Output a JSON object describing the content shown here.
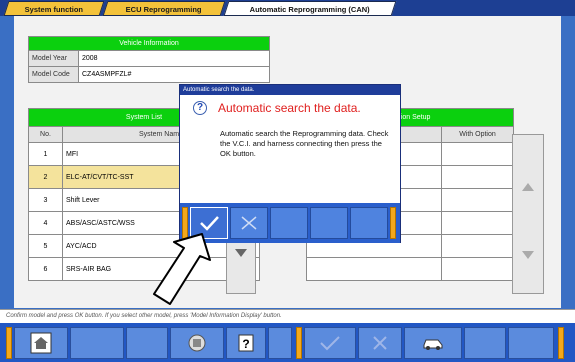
{
  "tabs": [
    "System function",
    "ECU Reprogramming",
    "Automatic Reprogramming (CAN)"
  ],
  "vehicle_info": {
    "header": "Vehicle Information",
    "fields": [
      {
        "label": "Model Year",
        "value": "2008"
      },
      {
        "label": "Model Code",
        "value": "CZ4ASMPFZL#"
      }
    ]
  },
  "system_list": {
    "header": "System List",
    "col_no": "No.",
    "col_name": "System Name",
    "rows": [
      {
        "no": "1",
        "name": "MFI"
      },
      {
        "no": "2",
        "name": "ELC-AT/CVT/TC-SST"
      },
      {
        "no": "3",
        "name": "Shift Lever"
      },
      {
        "no": "4",
        "name": "ABS/ASC/ASTC/WSS"
      },
      {
        "no": "5",
        "name": "AYC/ACD"
      },
      {
        "no": "6",
        "name": "SRS-AIR BAG"
      }
    ],
    "selected_index": 1
  },
  "option_setup": {
    "header": "Option Setup",
    "col_name_partial": "me",
    "col_with_option": "With Option"
  },
  "status_text": "Confirm model and press OK button. If you select other model, press 'Model Information Display' button.",
  "dialog": {
    "title": "Automatic search the data.",
    "heading": "Automatic search the data.",
    "message": "Automatic search the Reprogramming data. Check the V.C.I. and harness connecting then press the OK button."
  },
  "colors": {
    "accent_green": "#0bd00e",
    "tab_yellow": "#f3c23a",
    "toolbar_blue": "#2257c4",
    "dialog_heading_red": "#e0201f"
  }
}
